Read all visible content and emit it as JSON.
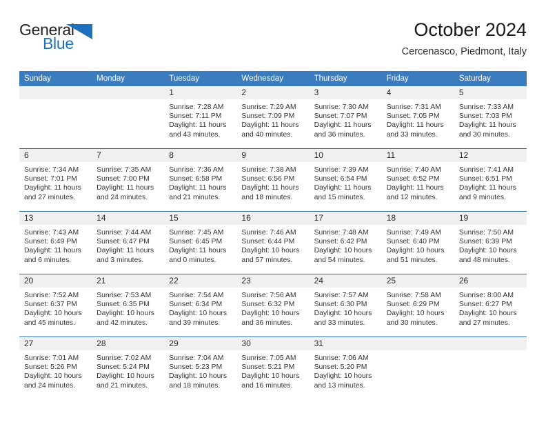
{
  "brand": {
    "name_part1": "General",
    "name_part2": "Blue",
    "triangle_color": "#1e72bb"
  },
  "header": {
    "title": "October 2024",
    "location": "Cercenasco, Piedmont, Italy"
  },
  "theme": {
    "header_blue": "#3b7cbf",
    "row_divider_blue": "#2e6da4",
    "daynum_band": "#f0f0f0"
  },
  "columns": [
    "Sunday",
    "Monday",
    "Tuesday",
    "Wednesday",
    "Thursday",
    "Friday",
    "Saturday"
  ],
  "weeks": [
    [
      {
        "day": "",
        "sunrise": "",
        "sunset": "",
        "daylight1": "",
        "daylight2": ""
      },
      {
        "day": "",
        "sunrise": "",
        "sunset": "",
        "daylight1": "",
        "daylight2": ""
      },
      {
        "day": "1",
        "sunrise": "Sunrise: 7:28 AM",
        "sunset": "Sunset: 7:11 PM",
        "daylight1": "Daylight: 11 hours",
        "daylight2": "and 43 minutes."
      },
      {
        "day": "2",
        "sunrise": "Sunrise: 7:29 AM",
        "sunset": "Sunset: 7:09 PM",
        "daylight1": "Daylight: 11 hours",
        "daylight2": "and 40 minutes."
      },
      {
        "day": "3",
        "sunrise": "Sunrise: 7:30 AM",
        "sunset": "Sunset: 7:07 PM",
        "daylight1": "Daylight: 11 hours",
        "daylight2": "and 36 minutes."
      },
      {
        "day": "4",
        "sunrise": "Sunrise: 7:31 AM",
        "sunset": "Sunset: 7:05 PM",
        "daylight1": "Daylight: 11 hours",
        "daylight2": "and 33 minutes."
      },
      {
        "day": "5",
        "sunrise": "Sunrise: 7:33 AM",
        "sunset": "Sunset: 7:03 PM",
        "daylight1": "Daylight: 11 hours",
        "daylight2": "and 30 minutes."
      }
    ],
    [
      {
        "day": "6",
        "sunrise": "Sunrise: 7:34 AM",
        "sunset": "Sunset: 7:01 PM",
        "daylight1": "Daylight: 11 hours",
        "daylight2": "and 27 minutes."
      },
      {
        "day": "7",
        "sunrise": "Sunrise: 7:35 AM",
        "sunset": "Sunset: 7:00 PM",
        "daylight1": "Daylight: 11 hours",
        "daylight2": "and 24 minutes."
      },
      {
        "day": "8",
        "sunrise": "Sunrise: 7:36 AM",
        "sunset": "Sunset: 6:58 PM",
        "daylight1": "Daylight: 11 hours",
        "daylight2": "and 21 minutes."
      },
      {
        "day": "9",
        "sunrise": "Sunrise: 7:38 AM",
        "sunset": "Sunset: 6:56 PM",
        "daylight1": "Daylight: 11 hours",
        "daylight2": "and 18 minutes."
      },
      {
        "day": "10",
        "sunrise": "Sunrise: 7:39 AM",
        "sunset": "Sunset: 6:54 PM",
        "daylight1": "Daylight: 11 hours",
        "daylight2": "and 15 minutes."
      },
      {
        "day": "11",
        "sunrise": "Sunrise: 7:40 AM",
        "sunset": "Sunset: 6:52 PM",
        "daylight1": "Daylight: 11 hours",
        "daylight2": "and 12 minutes."
      },
      {
        "day": "12",
        "sunrise": "Sunrise: 7:41 AM",
        "sunset": "Sunset: 6:51 PM",
        "daylight1": "Daylight: 11 hours",
        "daylight2": "and 9 minutes."
      }
    ],
    [
      {
        "day": "13",
        "sunrise": "Sunrise: 7:43 AM",
        "sunset": "Sunset: 6:49 PM",
        "daylight1": "Daylight: 11 hours",
        "daylight2": "and 6 minutes."
      },
      {
        "day": "14",
        "sunrise": "Sunrise: 7:44 AM",
        "sunset": "Sunset: 6:47 PM",
        "daylight1": "Daylight: 11 hours",
        "daylight2": "and 3 minutes."
      },
      {
        "day": "15",
        "sunrise": "Sunrise: 7:45 AM",
        "sunset": "Sunset: 6:45 PM",
        "daylight1": "Daylight: 11 hours",
        "daylight2": "and 0 minutes."
      },
      {
        "day": "16",
        "sunrise": "Sunrise: 7:46 AM",
        "sunset": "Sunset: 6:44 PM",
        "daylight1": "Daylight: 10 hours",
        "daylight2": "and 57 minutes."
      },
      {
        "day": "17",
        "sunrise": "Sunrise: 7:48 AM",
        "sunset": "Sunset: 6:42 PM",
        "daylight1": "Daylight: 10 hours",
        "daylight2": "and 54 minutes."
      },
      {
        "day": "18",
        "sunrise": "Sunrise: 7:49 AM",
        "sunset": "Sunset: 6:40 PM",
        "daylight1": "Daylight: 10 hours",
        "daylight2": "and 51 minutes."
      },
      {
        "day": "19",
        "sunrise": "Sunrise: 7:50 AM",
        "sunset": "Sunset: 6:39 PM",
        "daylight1": "Daylight: 10 hours",
        "daylight2": "and 48 minutes."
      }
    ],
    [
      {
        "day": "20",
        "sunrise": "Sunrise: 7:52 AM",
        "sunset": "Sunset: 6:37 PM",
        "daylight1": "Daylight: 10 hours",
        "daylight2": "and 45 minutes."
      },
      {
        "day": "21",
        "sunrise": "Sunrise: 7:53 AM",
        "sunset": "Sunset: 6:35 PM",
        "daylight1": "Daylight: 10 hours",
        "daylight2": "and 42 minutes."
      },
      {
        "day": "22",
        "sunrise": "Sunrise: 7:54 AM",
        "sunset": "Sunset: 6:34 PM",
        "daylight1": "Daylight: 10 hours",
        "daylight2": "and 39 minutes."
      },
      {
        "day": "23",
        "sunrise": "Sunrise: 7:56 AM",
        "sunset": "Sunset: 6:32 PM",
        "daylight1": "Daylight: 10 hours",
        "daylight2": "and 36 minutes."
      },
      {
        "day": "24",
        "sunrise": "Sunrise: 7:57 AM",
        "sunset": "Sunset: 6:30 PM",
        "daylight1": "Daylight: 10 hours",
        "daylight2": "and 33 minutes."
      },
      {
        "day": "25",
        "sunrise": "Sunrise: 7:58 AM",
        "sunset": "Sunset: 6:29 PM",
        "daylight1": "Daylight: 10 hours",
        "daylight2": "and 30 minutes."
      },
      {
        "day": "26",
        "sunrise": "Sunrise: 8:00 AM",
        "sunset": "Sunset: 6:27 PM",
        "daylight1": "Daylight: 10 hours",
        "daylight2": "and 27 minutes."
      }
    ],
    [
      {
        "day": "27",
        "sunrise": "Sunrise: 7:01 AM",
        "sunset": "Sunset: 5:26 PM",
        "daylight1": "Daylight: 10 hours",
        "daylight2": "and 24 minutes."
      },
      {
        "day": "28",
        "sunrise": "Sunrise: 7:02 AM",
        "sunset": "Sunset: 5:24 PM",
        "daylight1": "Daylight: 10 hours",
        "daylight2": "and 21 minutes."
      },
      {
        "day": "29",
        "sunrise": "Sunrise: 7:04 AM",
        "sunset": "Sunset: 5:23 PM",
        "daylight1": "Daylight: 10 hours",
        "daylight2": "and 18 minutes."
      },
      {
        "day": "30",
        "sunrise": "Sunrise: 7:05 AM",
        "sunset": "Sunset: 5:21 PM",
        "daylight1": "Daylight: 10 hours",
        "daylight2": "and 16 minutes."
      },
      {
        "day": "31",
        "sunrise": "Sunrise: 7:06 AM",
        "sunset": "Sunset: 5:20 PM",
        "daylight1": "Daylight: 10 hours",
        "daylight2": "and 13 minutes."
      },
      {
        "day": "",
        "sunrise": "",
        "sunset": "",
        "daylight1": "",
        "daylight2": ""
      },
      {
        "day": "",
        "sunrise": "",
        "sunset": "",
        "daylight1": "",
        "daylight2": ""
      }
    ]
  ]
}
